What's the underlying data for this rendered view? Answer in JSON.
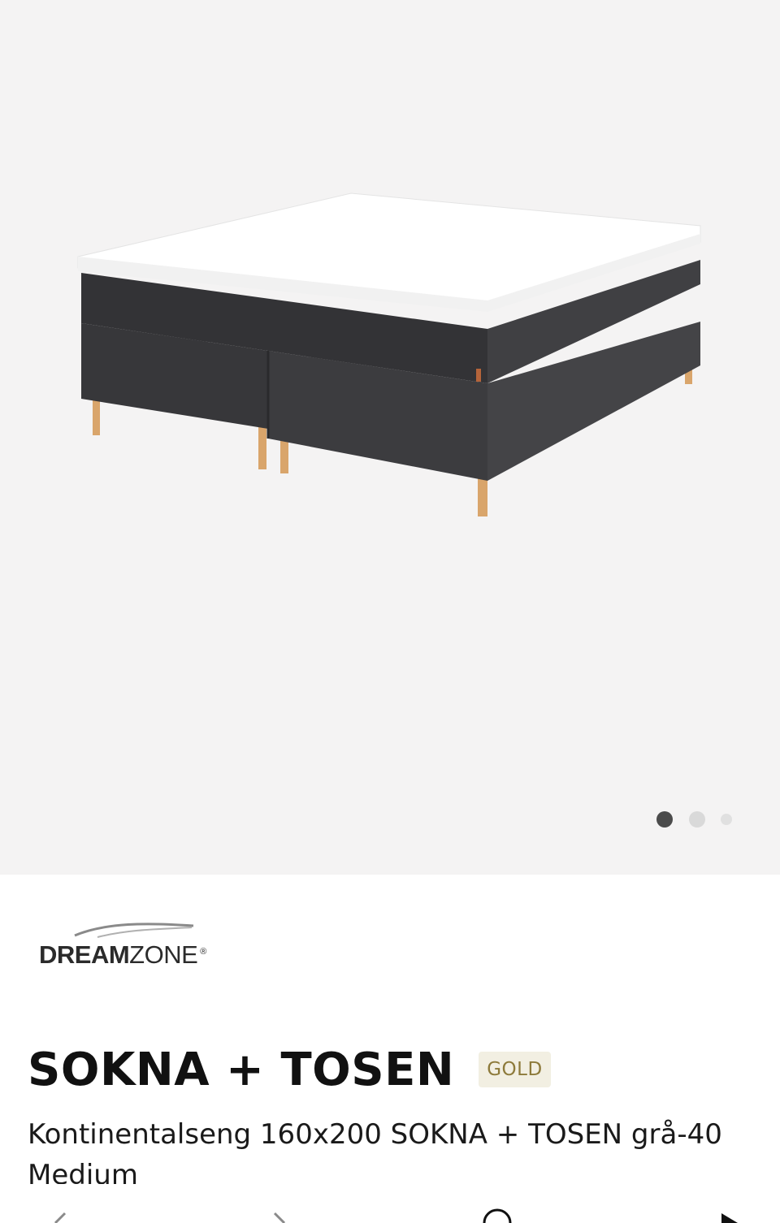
{
  "gallery": {
    "image_alt": "Kontinentalseng SOKNA + TOSEN",
    "dots": [
      {
        "active": true
      },
      {
        "active": false
      },
      {
        "active": false
      }
    ]
  },
  "brand": {
    "part1": "DREAM",
    "part2": "ZONE",
    "registered": "®"
  },
  "product": {
    "title": "SOKNA + TOSEN",
    "badge": "GOLD",
    "subtitle": "Kontinentalseng 160x200 SOKNA + TOSEN grå-40 Medium"
  },
  "bottom_nav": {
    "icons": [
      "back-icon",
      "forward-icon",
      "refresh-icon",
      "play-icon"
    ]
  },
  "colors": {
    "gallery_bg": "#f4f3f3",
    "badge_bg": "#f2efe2",
    "badge_text": "#8d7a3a",
    "bed_fabric": "#3a3a3c",
    "leg_wood": "#d9a56b"
  }
}
